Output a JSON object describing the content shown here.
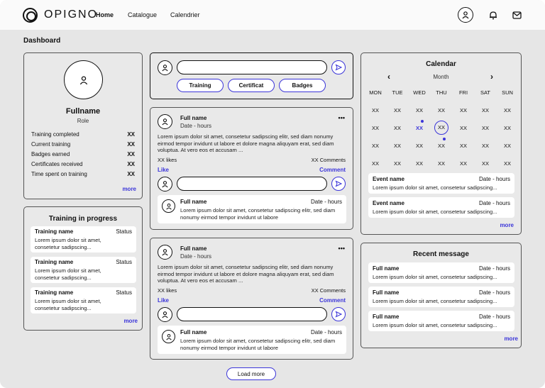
{
  "header": {
    "logo_text": "OPIGNO",
    "nav": [
      "Home",
      "Catalogue",
      "Calendrier"
    ]
  },
  "page_title": "Dashboard",
  "profile": {
    "name": "Fullname",
    "role": "Role",
    "stats": [
      {
        "label": "Training completed",
        "value": "XX"
      },
      {
        "label": "Current training",
        "value": "XX"
      },
      {
        "label": "Badges earned",
        "value": "XX"
      },
      {
        "label": "Certificates received",
        "value": "XX"
      },
      {
        "label": "Time spent on training",
        "value": "XX"
      }
    ],
    "more": "more"
  },
  "training": {
    "title": "Training in progress",
    "items": [
      {
        "name": "Training name",
        "status": "Status",
        "desc": "Lorem ipsum dolor sit amet, consetetur sadipscing..."
      },
      {
        "name": "Training name",
        "status": "Status",
        "desc": "Lorem ipsum dolor sit amet, consetetur sadipscing..."
      },
      {
        "name": "Training name",
        "status": "Status",
        "desc": "Lorem ipsum dolor sit amet, consetetur sadipscing..."
      }
    ],
    "more": "more"
  },
  "composer": {
    "chips": [
      "Training",
      "Certificat",
      "Badges"
    ]
  },
  "posts": [
    {
      "author": "Full name",
      "date": "Date - hours",
      "menu": "•••",
      "body": "Lorem ipsum dolor sit amet, consetetur sadipscing elitr, sed diam nonumy eirmod tempor invidunt ut labore et dolore magna aliquyam erat, sed diam voluptua. At vero eos et accusam ...",
      "likes": "XX likes",
      "comments": "XX Comments",
      "like": "Like",
      "comment": "Comment",
      "reply": {
        "author": "Full name",
        "date": "Date - hours",
        "body": "Lorem ipsum dolor sit amet, consetetur sadipscing elitr, sed diam nonumy eirmod tempor invidunt ut labore"
      }
    },
    {
      "author": "Full name",
      "date": "Date - hours",
      "menu": "•••",
      "body": "Lorem ipsum dolor sit amet, consetetur sadipscing elitr, sed diam nonumy eirmod tempor invidunt ut labore et dolore magna aliquyam erat, sed diam voluptua. At vero eos et accusam ...",
      "likes": "XX likes",
      "comments": "XX Comments",
      "like": "Like",
      "comment": "Comment",
      "reply": {
        "author": "Full name",
        "date": "Date - hours",
        "body": "Lorem ipsum dolor sit amet, consetetur sadipscing elitr, sed diam nonumy eirmod tempor invidunt ut labore"
      }
    }
  ],
  "load_more": "Load more",
  "calendar": {
    "title": "Calendar",
    "month": "Month",
    "prev": "‹",
    "next": "›",
    "days": [
      "MON",
      "TUE",
      "WED",
      "THU",
      "FRI",
      "SAT",
      "SUN"
    ],
    "rows": [
      [
        "XX",
        "XX",
        "XX",
        "XX",
        "XX",
        "XX",
        "XX"
      ],
      [
        "XX",
        "XX",
        "XX",
        "XX",
        "XX",
        "XX",
        "XX"
      ],
      [
        "XX",
        "XX",
        "XX",
        "XX",
        "XX",
        "XX",
        "XX"
      ],
      [
        "XX",
        "XX",
        "XX",
        "XX",
        "XX",
        "XX",
        "XX"
      ]
    ],
    "events": [
      {
        "name": "Event name",
        "date": "Date - hours",
        "desc": "Lorem ipsum dolor sit amet, consetetur sadipscing..."
      },
      {
        "name": "Event name",
        "date": "Date - hours",
        "desc": "Lorem ipsum dolor sit amet, consetetur sadipscing..."
      }
    ],
    "more": "more",
    "accent": "#3b35d9"
  },
  "messages": {
    "title": "Recent message",
    "items": [
      {
        "name": "Full name",
        "date": "Date - hours",
        "desc": "Lorem ipsum dolor sit amet, consetetur sadipscing..."
      },
      {
        "name": "Full name",
        "date": "Date - hours",
        "desc": "Lorem ipsum dolor sit amet, consetetur sadipscing..."
      },
      {
        "name": "Full name",
        "date": "Date - hours",
        "desc": "Lorem ipsum dolor sit amet, consetetur sadipscing..."
      }
    ],
    "more": "more"
  }
}
